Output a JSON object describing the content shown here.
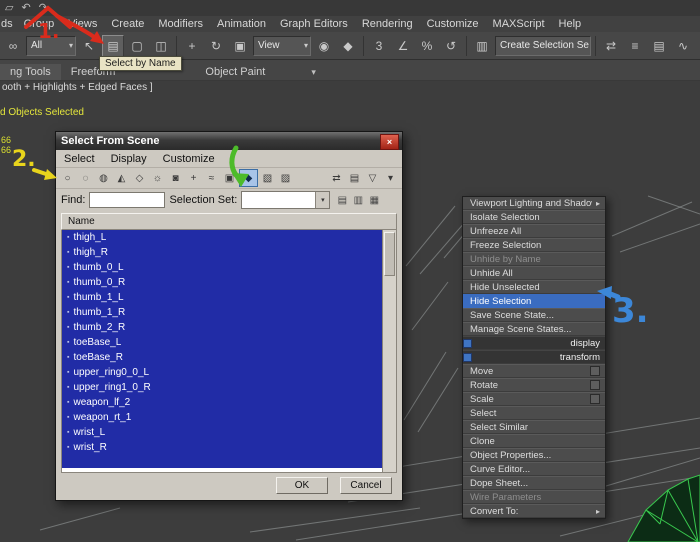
{
  "titlebar": {
    "icons": [
      {
        "name": "new-scene-icon",
        "glyph": "▱"
      },
      {
        "name": "undo-icon",
        "glyph": "↶"
      },
      {
        "name": "redo-icon",
        "glyph": "↷"
      }
    ]
  },
  "menubar": {
    "items": [
      {
        "label": "ds",
        "partial": true
      },
      {
        "label": "Group"
      },
      {
        "label": "Views"
      },
      {
        "label": "Create"
      },
      {
        "label": "Modifiers"
      },
      {
        "label": "Animation"
      },
      {
        "label": "Graph Editors"
      },
      {
        "label": "Rendering"
      },
      {
        "label": "Customize"
      },
      {
        "label": "MAXScript"
      },
      {
        "label": "Help"
      }
    ]
  },
  "main_toolbar": {
    "tooltip": "Select by Name",
    "items": [
      {
        "kind": "icon",
        "name": "bind-to-space-warp-icon",
        "glyph": "∞"
      },
      {
        "kind": "combo",
        "name": "selection-filter-combo",
        "value": "All"
      },
      {
        "kind": "icon",
        "name": "select-object-icon",
        "glyph": "↖"
      },
      {
        "kind": "icon",
        "name": "select-by-name-icon",
        "glyph": "▤",
        "pressed": true
      },
      {
        "kind": "icon",
        "name": "rectangular-selection-region-icon",
        "glyph": "▢"
      },
      {
        "kind": "icon",
        "name": "window-crossing-icon",
        "glyph": "◫"
      },
      {
        "kind": "sep"
      },
      {
        "kind": "icon",
        "name": "select-and-move-icon",
        "glyph": "+"
      },
      {
        "kind": "icon",
        "name": "select-and-rotate-icon",
        "glyph": "↻"
      },
      {
        "kind": "icon",
        "name": "select-and-scale-icon",
        "glyph": "▣"
      },
      {
        "kind": "combo",
        "name": "reference-coordinate-system-combo",
        "value": "View"
      },
      {
        "kind": "icon",
        "name": "use-pivot-point-center-icon",
        "glyph": "◉"
      },
      {
        "kind": "icon",
        "name": "select-and-manipulate-icon",
        "glyph": "◆"
      },
      {
        "kind": "sep"
      },
      {
        "kind": "icon",
        "name": "snap-toggle-3d-icon",
        "glyph": "3"
      },
      {
        "kind": "icon",
        "name": "angle-snap-toggle-icon",
        "glyph": "∠"
      },
      {
        "kind": "icon",
        "name": "percent-snap-toggle-icon",
        "glyph": "%"
      },
      {
        "kind": "icon",
        "name": "spinner-snap-toggle-icon",
        "glyph": "↺"
      },
      {
        "kind": "sep"
      },
      {
        "kind": "icon",
        "name": "edit-named-selection-sets-icon",
        "glyph": "▥"
      },
      {
        "kind": "combo",
        "name": "named-selection-sets-combo",
        "value": "Create Selection Se"
      },
      {
        "kind": "sep"
      },
      {
        "kind": "icon",
        "name": "mirror-icon",
        "glyph": "⇄"
      },
      {
        "kind": "icon",
        "name": "align-icon",
        "glyph": "≡"
      },
      {
        "kind": "icon",
        "name": "layer-manager-icon",
        "glyph": "▤"
      },
      {
        "kind": "icon",
        "name": "curve-editor-icon",
        "glyph": "∿"
      },
      {
        "kind": "icon",
        "name": "schematic-view-icon",
        "glyph": "⊞"
      },
      {
        "kind": "icon",
        "name": "material-editor-icon",
        "glyph": "◩"
      },
      {
        "kind": "icon",
        "name": "render-setup-icon",
        "glyph": "▭",
        "blue": true
      }
    ]
  },
  "ribbon": {
    "tabs": [
      "ng Tools",
      "Freeform",
      "Object Paint"
    ]
  },
  "viewport": {
    "shading_label": "ooth + Highlights + Edged Faces ]",
    "selected_label": "d Objects Selected",
    "counts": [
      "66",
      "66"
    ]
  },
  "dialog": {
    "title": "Select From Scene",
    "close_glyph": "×",
    "menus": [
      "Select",
      "Display",
      "Customize"
    ],
    "toolbar_icons": [
      {
        "name": "display-all-icon",
        "glyph": "○"
      },
      {
        "name": "display-none-icon",
        "glyph": "◌"
      },
      {
        "name": "display-invert-icon",
        "glyph": "◍"
      },
      {
        "name": "display-geometry-icon",
        "glyph": "◭"
      },
      {
        "name": "display-shapes-icon",
        "glyph": "◇"
      },
      {
        "name": "display-lights-icon",
        "glyph": "☼"
      },
      {
        "name": "display-cameras-icon",
        "glyph": "◙"
      },
      {
        "name": "display-helpers-icon",
        "glyph": "+"
      },
      {
        "name": "display-space-warps-icon",
        "glyph": "≈"
      },
      {
        "name": "display-groups-icon",
        "glyph": "▣"
      },
      {
        "name": "display-bones-icon",
        "glyph": "◆",
        "active": true
      },
      {
        "name": "display-frozen-icon",
        "glyph": "▧"
      },
      {
        "name": "display-hidden-icon",
        "glyph": "▨"
      },
      {
        "name": "sync-selection-icon",
        "glyph": "⇄",
        "right": true
      },
      {
        "name": "show-columns-icon",
        "glyph": "▤",
        "right": true
      },
      {
        "name": "filter-icon",
        "glyph": "▽",
        "right": true
      },
      {
        "name": "filter-dropdown-icon",
        "glyph": "▾",
        "right": true
      }
    ],
    "find_label": "Find:",
    "find_value": "",
    "selection_set_label": "Selection Set:",
    "selection_set_value": "",
    "set_icons": [
      {
        "name": "create-named-set-icon",
        "glyph": "▤"
      },
      {
        "name": "add-to-set-icon",
        "glyph": "▥"
      },
      {
        "name": "remove-from-set-icon",
        "glyph": "▦"
      }
    ],
    "column_header": "Name",
    "items": [
      "thigh_L",
      "thigh_R",
      "thumb_0_L",
      "thumb_0_R",
      "thumb_1_L",
      "thumb_1_R",
      "thumb_2_R",
      "toeBase_L",
      "toeBase_R",
      "upper_ring0_0_L",
      "upper_ring1_0_R",
      "weapon_lf_2",
      "weapon_rt_1",
      "wrist_L",
      "wrist_R"
    ],
    "ok": "OK",
    "cancel": "Cancel"
  },
  "context_menu": {
    "items": [
      {
        "label": "Viewport Lighting and Shadows",
        "submenu": true
      },
      {
        "label": "Isolate Selection"
      },
      {
        "label": "Unfreeze All"
      },
      {
        "label": "Freeze Selection"
      },
      {
        "label": "Unhide by Name",
        "disabled": true
      },
      {
        "label": "Unhide All"
      },
      {
        "label": "Hide Unselected"
      },
      {
        "label": "Hide Selection",
        "highlighted": true
      },
      {
        "label": "Save Scene State..."
      },
      {
        "label": "Manage Scene States..."
      },
      {
        "label": "display",
        "header": true
      },
      {
        "label": "transform",
        "header": true
      },
      {
        "label": "Move",
        "box": true
      },
      {
        "label": "Rotate",
        "box": true
      },
      {
        "label": "Scale",
        "box": true
      },
      {
        "label": "Select"
      },
      {
        "label": "Select Similar"
      },
      {
        "label": "Clone"
      },
      {
        "label": "Object Properties..."
      },
      {
        "label": "Curve Editor..."
      },
      {
        "label": "Dope Sheet..."
      },
      {
        "label": "Wire Parameters",
        "disabled": true
      },
      {
        "label": "Convert To:",
        "submenu": true
      }
    ]
  },
  "annotations": {
    "step1": "1.",
    "step2": "2.",
    "step3": "3."
  },
  "colors": {
    "selection_blue": "#212ca6",
    "menu_highlight": "#3a6cc0",
    "annotation_red": "#d92b1c",
    "annotation_yellow": "#e8d41c",
    "annotation_green": "#4dbb2a",
    "annotation_blue": "#3c87d8",
    "mesh_green": "#39c84e",
    "mesh_fill": "#0c2c15",
    "wireframe_gray": "#a8adad"
  }
}
